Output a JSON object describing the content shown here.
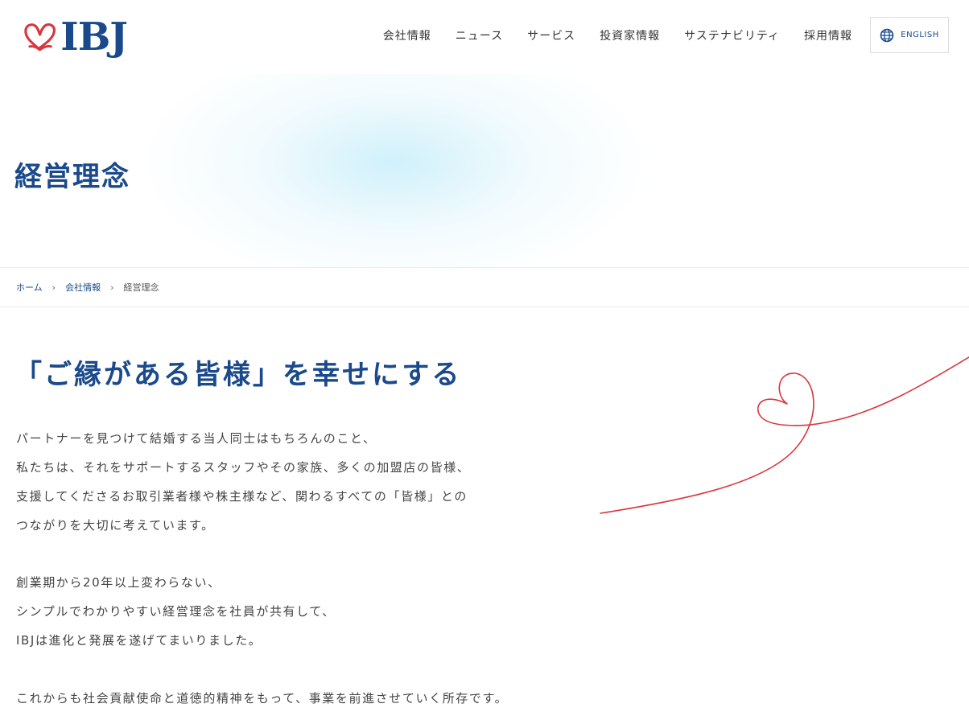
{
  "header": {
    "logo_text": "IBJ",
    "nav": [
      {
        "label": "会社情報"
      },
      {
        "label": "ニュース"
      },
      {
        "label": "サービス"
      },
      {
        "label": "投資家情報"
      },
      {
        "label": "サステナビリティ"
      },
      {
        "label": "採用情報"
      }
    ],
    "lang_label": "ENGLISH"
  },
  "hero": {
    "title": "経営理念"
  },
  "breadcrumb": [
    {
      "label": "ホーム"
    },
    {
      "label": "会社情報"
    },
    {
      "label": "経営理念"
    }
  ],
  "content": {
    "catch": "「ご縁がある皆様」を幸せにする",
    "paragraphs": [
      [
        "パートナーを見つけて結婚する当人同士はもちろんのこと、",
        "私たちは、それをサポートするスタッフやその家族、多くの加盟店の皆様、",
        "支援してくださるお取引業者様や株主様など、関わるすべての「皆様」との",
        "つながりを大切に考えています。"
      ],
      [
        "創業期から20年以上変わらない、",
        "シンプルでわかりやすい経営理念を社員が共有して、",
        "IBJは進化と発展を遂げてまいりました。"
      ],
      [
        "これからも社会貢献使命と道徳的精神をもって、事業を前進させていく所存です。"
      ]
    ]
  },
  "colors": {
    "brand_blue": "#1a4a8c",
    "heart_red": "#d9363e",
    "hero_tint": "#c8eefa"
  },
  "icons": {
    "logo": "heart-logo-icon",
    "lang": "globe-icon",
    "breadcrumb_sep": "chevron-right-icon",
    "decoration": "red-thread-heart"
  }
}
